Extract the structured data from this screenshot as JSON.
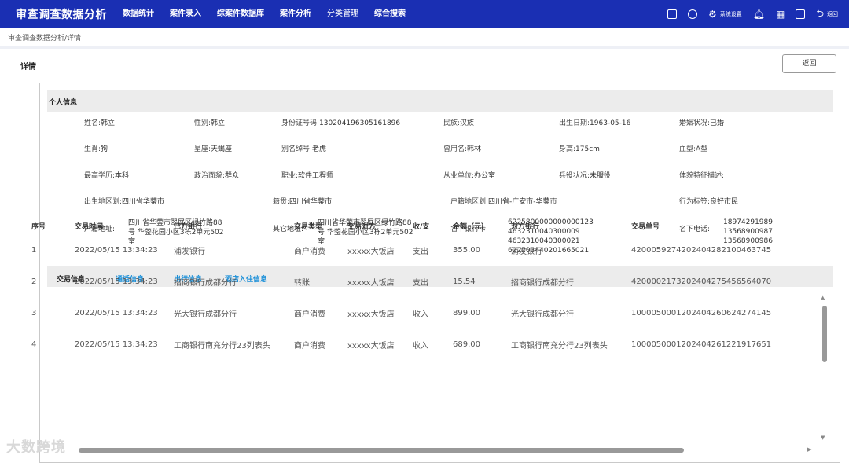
{
  "app_title": "审查调查数据分析",
  "nav": [
    "数据统计",
    "案件录入",
    "综案件数据库",
    "案件分析",
    "分类管理",
    "综合搜索"
  ],
  "nav_right": {
    "settings_label": "系统设置",
    "back_label": "返回"
  },
  "breadcrumb": "审查调查数据分析/详情",
  "detail_title": "详情",
  "back_button": "返回",
  "personal": {
    "section_title": "个人信息",
    "fields": [
      {
        "k": "姓名:",
        "v": "韩立"
      },
      {
        "k": "性别:",
        "v": "韩立"
      },
      {
        "k": "身份证号码:",
        "v": "130204196305161896"
      },
      {
        "k": "民族:",
        "v": "汉族"
      },
      {
        "k": "出生日期:",
        "v": "1963-05-16"
      },
      {
        "k": "婚姻状况:",
        "v": "已婚"
      },
      {
        "k": "生肖:",
        "v": "狗"
      },
      {
        "k": "星座:",
        "v": "天蝎座"
      },
      {
        "k": "别名绰号:",
        "v": "老虎"
      },
      {
        "k": "曾用名:",
        "v": "韩林"
      },
      {
        "k": "身高:",
        "v": "175cm"
      },
      {
        "k": "血型:",
        "v": "A型"
      },
      {
        "k": "最高学历:",
        "v": "本科"
      },
      {
        "k": "政治面貌:",
        "v": "群众"
      },
      {
        "k": "职业:",
        "v": "软件工程师"
      },
      {
        "k": "从业单位:",
        "v": "办公室"
      },
      {
        "k": "兵役状况:",
        "v": "未服役"
      },
      {
        "k": "体貌特征描述:",
        "v": ""
      },
      {
        "k": "出生地区划:",
        "v": "四川省华蓥市"
      },
      {
        "k": "籍贯:",
        "v": "四川省华蓥市"
      },
      {
        "k": "户籍地区划:",
        "v": "四川省-广安市-华蓥市"
      },
      {
        "k": "行为标签:",
        "v": "良好市民"
      }
    ],
    "hukou_label": "户籍地址:",
    "hukou_lines": [
      "四川省华蓥市翠屏区绿竹路88",
      "号 华蓥花园小区3栋2单元502",
      "室"
    ],
    "other_label": "其它地址:",
    "other_lines": [
      "四川省华蓥市翠屏区绿竹路88",
      "号 华蓥花园小区3栋2单元502",
      "室"
    ],
    "bank_label": "名下银行卡:",
    "bank_lines": [
      "6225800000000000123",
      "4632310040300009",
      "4632310040300021",
      "622203440201665021"
    ],
    "phone_label": "名下电话:",
    "phone_lines": [
      "18974291989",
      "13568900987",
      "13568900986"
    ]
  },
  "tabs": [
    "交易信息",
    "通话信息",
    "出行信息",
    "酒店入住信息"
  ],
  "table": {
    "headers": [
      "序号",
      "交易时间",
      "己方银行",
      "交易类型",
      "交易对方",
      "收/支",
      "金额（元）",
      "对方银行",
      "交易单号"
    ],
    "rows": [
      [
        "1",
        "2022/05/15  13:34:23",
        "浦发银行",
        "商户消费",
        "xxxxx大饭店",
        "支出",
        "355.00",
        "浦发银行",
        "4200059274202404282100463745"
      ],
      [
        "2",
        "2022/05/15  13:34:23",
        "招商银行成都分行",
        "转账",
        "xxxxx大饭店",
        "支出",
        "15.54",
        "招商银行成都分行",
        "4200002173202404275456564070"
      ],
      [
        "3",
        "2022/05/15  13:34:23",
        "光大银行成都分行",
        "商户消费",
        "xxxxx大饭店",
        "收入",
        "899.00",
        "光大银行成都分行",
        "1000050001202404260624274145"
      ],
      [
        "4",
        "2022/05/15  13:34:23",
        "工商银行南充分行23列表头",
        "商户消费",
        "xxxxx大饭店",
        "收入",
        "689.00",
        "工商银行南充分行23列表头",
        "1000050001202404261221917651"
      ]
    ]
  },
  "watermark": "大数跨境"
}
